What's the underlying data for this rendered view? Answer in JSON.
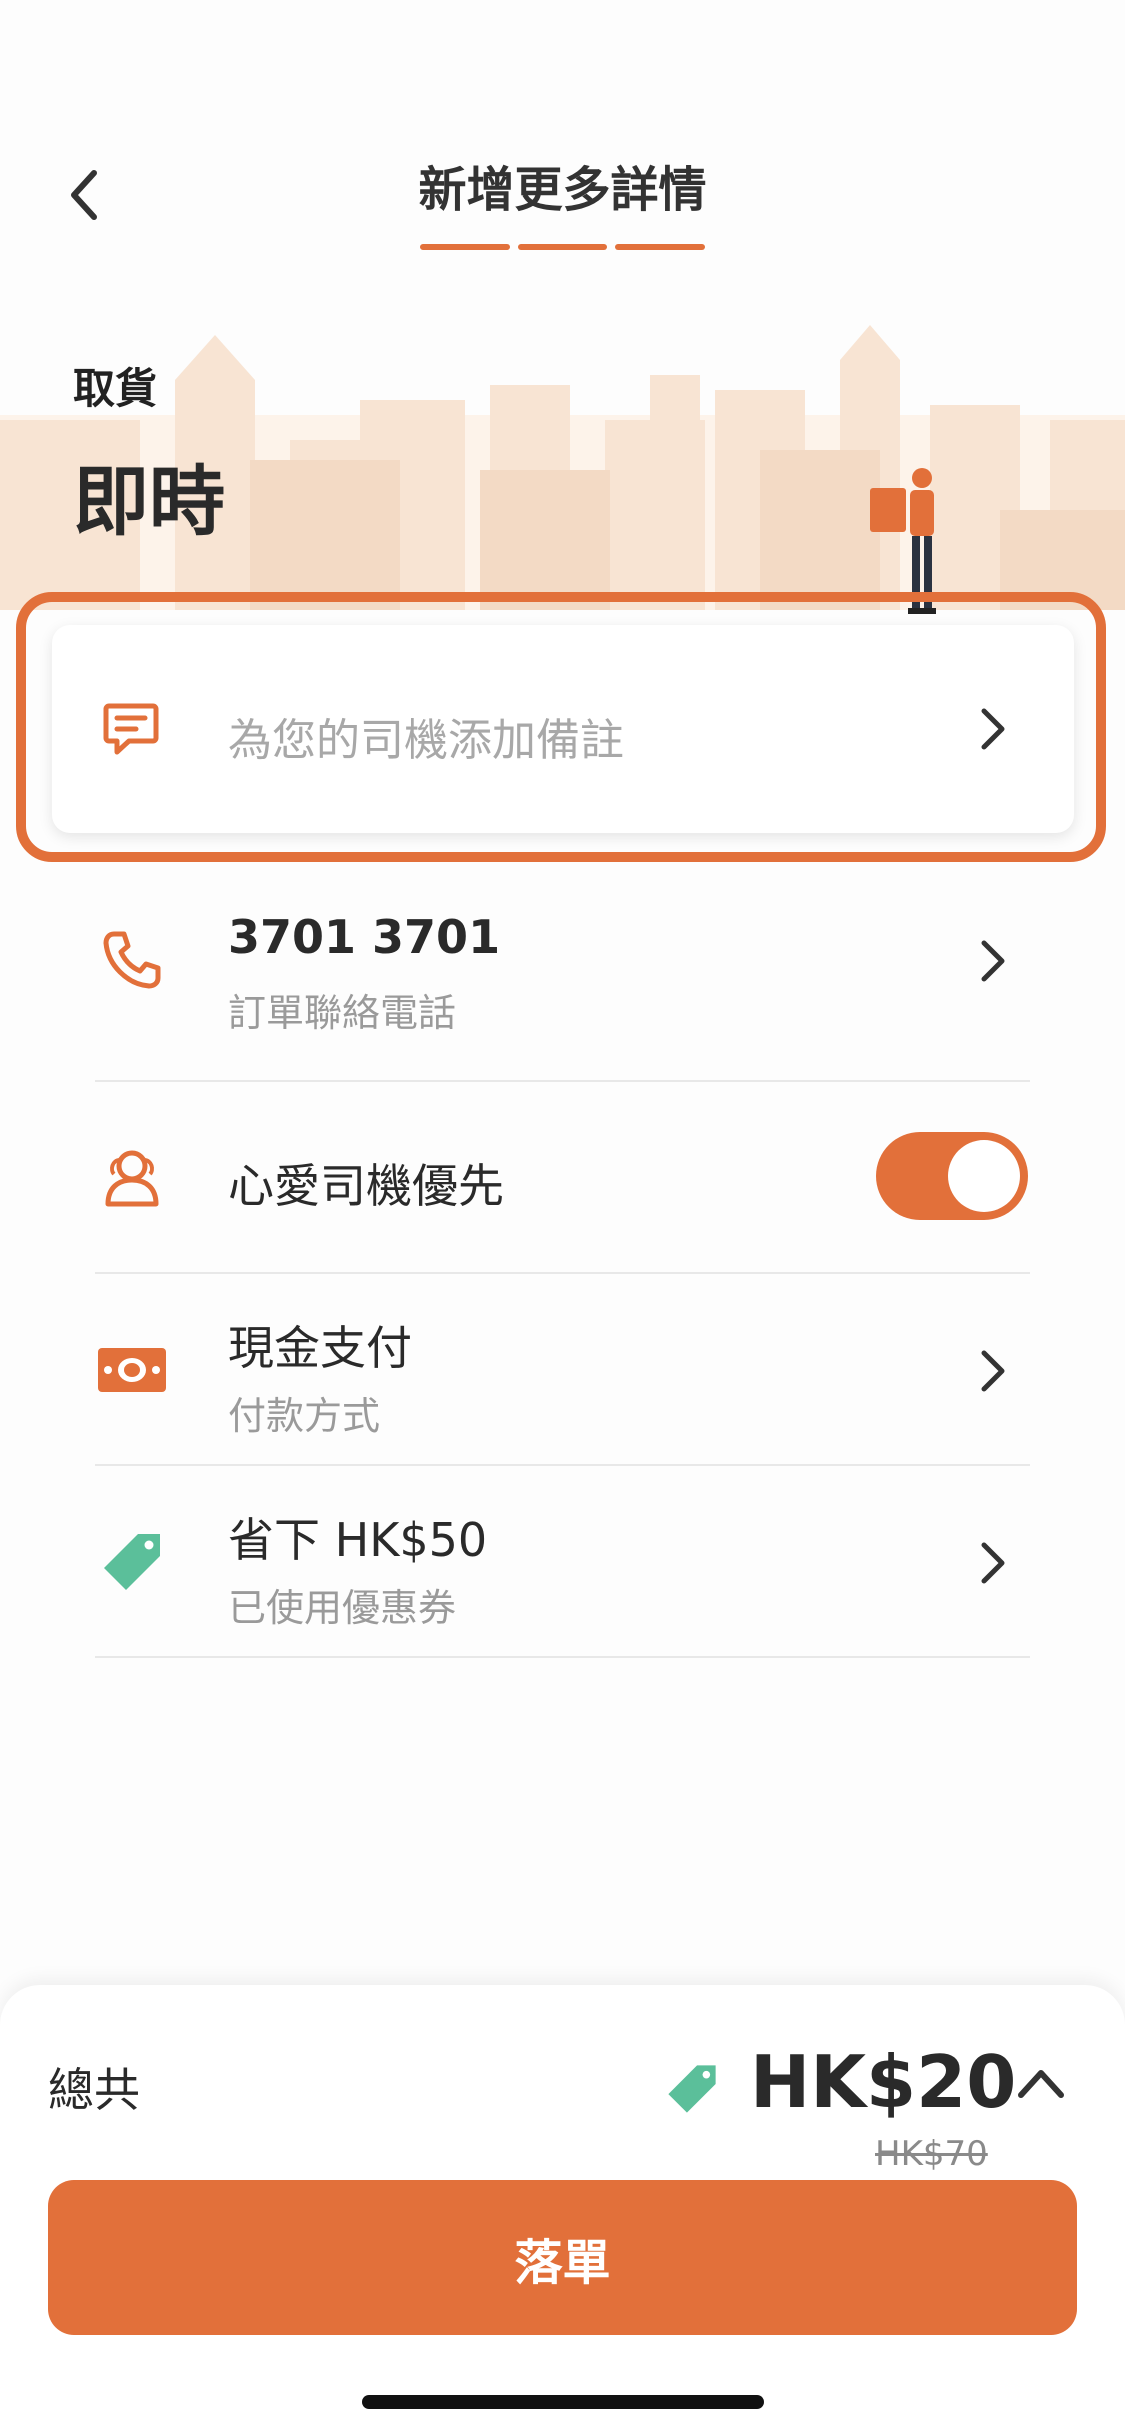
{
  "header": {
    "title": "新增更多詳情",
    "back_icon": "chevron-left-icon"
  },
  "pickup": {
    "label": "取貨",
    "value": "即時"
  },
  "note": {
    "placeholder": "為您的司機添加備註",
    "icon": "message-icon"
  },
  "options": [
    {
      "title": "3701 3701",
      "subtitle": "訂單聯絡電話",
      "icon": "phone-icon"
    },
    {
      "title": "心愛司機優先",
      "subtitle": "",
      "icon": "driver-icon",
      "toggle_on": true
    },
    {
      "title": "現金支付",
      "subtitle": "付款方式",
      "icon": "cash-icon"
    },
    {
      "title": "省下 HK$50",
      "subtitle": "已使用優惠券",
      "icon": "coupon-tag-icon"
    }
  ],
  "footer": {
    "total_label": "總共",
    "price": "HK$20",
    "original_price": "HK$70",
    "order_button": "落單"
  },
  "colors": {
    "accent": "#e2703a",
    "coupon": "#5bbf9a"
  }
}
